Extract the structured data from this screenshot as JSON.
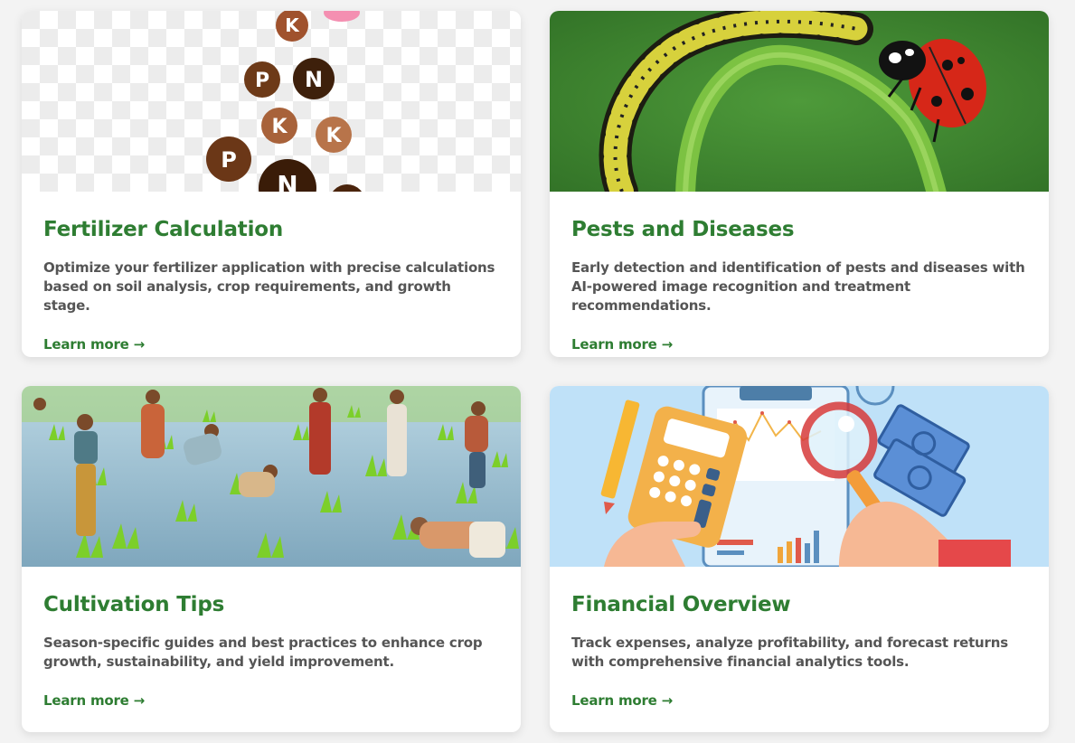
{
  "colors": {
    "accent": "#2e7d32",
    "text": "#555555",
    "background": "#f3f3f3"
  },
  "cards": [
    {
      "title": "Fertilizer Calculation",
      "description": "Optimize your fertilizer application with precise calculations based on soil analysis, crop requirements, and growth stage.",
      "link": "Learn more →",
      "image": "npk-fertilizer-pellets"
    },
    {
      "title": "Pests and Diseases",
      "description": "Early detection and identification of pests and diseases with AI-powered image recognition and treatment recommendations.",
      "link": "Learn more →",
      "image": "caterpillar-and-ladybug"
    },
    {
      "title": "Cultivation Tips",
      "description": "Season-specific guides and best practices to enhance crop growth, sustainability, and yield improvement.",
      "link": "Learn more →",
      "image": "farmers-planting-rice"
    },
    {
      "title": "Financial Overview",
      "description": "Track expenses, analyze profitability, and forecast returns with comprehensive financial analytics tools.",
      "link": "Learn more →",
      "image": "calculator-and-charts"
    }
  ],
  "npk_letters": [
    "K",
    "P",
    "N",
    "K",
    "K",
    "P",
    "N"
  ]
}
